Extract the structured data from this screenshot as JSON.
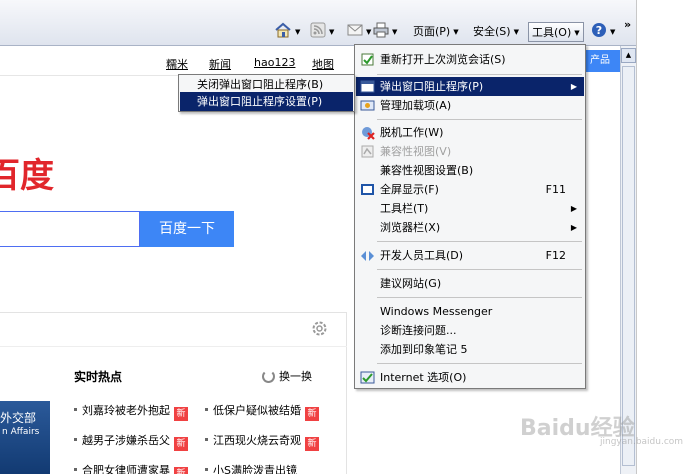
{
  "command_bar": {
    "page_label": "页面(P)",
    "safety_label": "安全(S)",
    "tools_label": "工具(O)",
    "more": "»"
  },
  "page": {
    "top_links": [
      "糯米",
      "新闻",
      "hao123",
      "地图"
    ],
    "logo_text": "百度",
    "search_button": "百度一下",
    "hot_title": "实时热点",
    "refresh_label": "换一换",
    "ad_line1": "外交部",
    "ad_line2": "n Affairs",
    "news_left": [
      "刘嘉玲被老外抱起",
      "越男子涉嫌杀岳父",
      "合肥女律师遭家暴"
    ],
    "news_right": [
      "低保户疑似被结婚",
      "江西现火烧云奇观",
      "小S满脸泼青出镜"
    ],
    "news_badge": "新",
    "side_label": "产品"
  },
  "tools_menu": {
    "items": [
      {
        "label": "重新打开上次浏览会话(S)",
        "shortcut": "",
        "submenu": false,
        "disabled": false,
        "icon": "reopen-session-icon"
      },
      {
        "label": "弹出窗口阻止程序(P)",
        "shortcut": "",
        "submenu": true,
        "disabled": false,
        "highlighted": true,
        "icon": "popup-blocker-icon"
      },
      {
        "label": "管理加载项(A)",
        "shortcut": "",
        "submenu": false,
        "disabled": false,
        "icon": "addons-icon"
      },
      {
        "label": "脱机工作(W)",
        "shortcut": "",
        "submenu": false,
        "disabled": false,
        "icon": "offline-icon"
      },
      {
        "label": "兼容性视图(V)",
        "shortcut": "",
        "submenu": false,
        "disabled": true,
        "icon": "compat-view-icon"
      },
      {
        "label": "兼容性视图设置(B)",
        "shortcut": "",
        "submenu": false,
        "disabled": false
      },
      {
        "label": "全屏显示(F)",
        "shortcut": "F11",
        "submenu": false,
        "disabled": false,
        "icon": "fullscreen-icon"
      },
      {
        "label": "工具栏(T)",
        "shortcut": "",
        "submenu": true,
        "disabled": false
      },
      {
        "label": "浏览器栏(X)",
        "shortcut": "",
        "submenu": true,
        "disabled": false
      },
      {
        "label": "开发人员工具(D)",
        "shortcut": "F12",
        "submenu": false,
        "disabled": false,
        "icon": "dev-tools-icon"
      },
      {
        "label": "建议网站(G)",
        "shortcut": "",
        "submenu": false,
        "disabled": false
      },
      {
        "label": "Windows Messenger",
        "shortcut": "",
        "submenu": false,
        "disabled": false
      },
      {
        "label": "诊断连接问题...",
        "shortcut": "",
        "submenu": false,
        "disabled": false
      },
      {
        "label": "添加到印象笔记 5",
        "shortcut": "",
        "submenu": false,
        "disabled": false
      },
      {
        "label": "Internet 选项(O)",
        "shortcut": "",
        "submenu": false,
        "disabled": false,
        "icon": "internet-options-icon"
      }
    ]
  },
  "popup_submenu": {
    "items": [
      {
        "label": "关闭弹出窗口阻止程序(B)",
        "highlighted": false
      },
      {
        "label": "弹出窗口阻止程序设置(P)",
        "highlighted": true
      }
    ]
  },
  "watermark": {
    "main": "Baidu经验",
    "sub": "jingyan.baidu.com"
  },
  "colors": {
    "menu_highlight": "#0a246a",
    "baidu_red": "#e1262b",
    "baidu_blue": "#3d86f6"
  }
}
